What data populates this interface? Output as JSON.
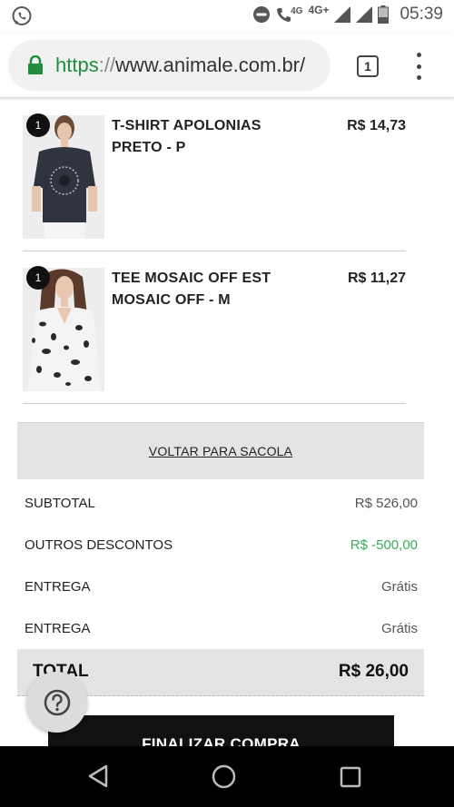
{
  "status_bar": {
    "network_label": "4G+",
    "call_label": "4G",
    "time": "05:39"
  },
  "browser": {
    "url_scheme": "https",
    "url_separator": "://",
    "url_host": "www.animale.com.br/",
    "tab_count": "1"
  },
  "cart": {
    "items": [
      {
        "quantity": "1",
        "name": "T-SHIRT APOLONIAS PRETO - P",
        "price": "R$ 14,73"
      },
      {
        "quantity": "1",
        "name": "TEE MOSAIC OFF EST MOSAIC OFF - M",
        "price": "R$ 11,27"
      }
    ],
    "back_to_bag_label": "VOLTAR PARA SACOLA"
  },
  "summary": {
    "subtotal_label": "SUBTOTAL",
    "subtotal_value": "R$ 526,00",
    "discount_label": "OUTROS DESCONTOS",
    "discount_value": "R$ -500,00",
    "shipping_1_label": "ENTREGA",
    "shipping_1_value": "Grátis",
    "shipping_2_label": "ENTREGA",
    "shipping_2_value": "Grátis",
    "total_label": "TOTAL",
    "total_value": "R$ 26,00"
  },
  "checkout_label": "FINALIZAR COMPRA",
  "icons": {
    "whatsapp": "whatsapp-icon",
    "dnd": "do-not-disturb-icon",
    "lock": "lock-icon",
    "help": "help-icon",
    "back": "nav-back-icon",
    "home": "nav-home-icon",
    "recents": "nav-recents-icon"
  },
  "colors": {
    "secure_green": "#1e8e3e",
    "discount_green": "#3aaa5a",
    "checkout_bg": "#111111"
  }
}
